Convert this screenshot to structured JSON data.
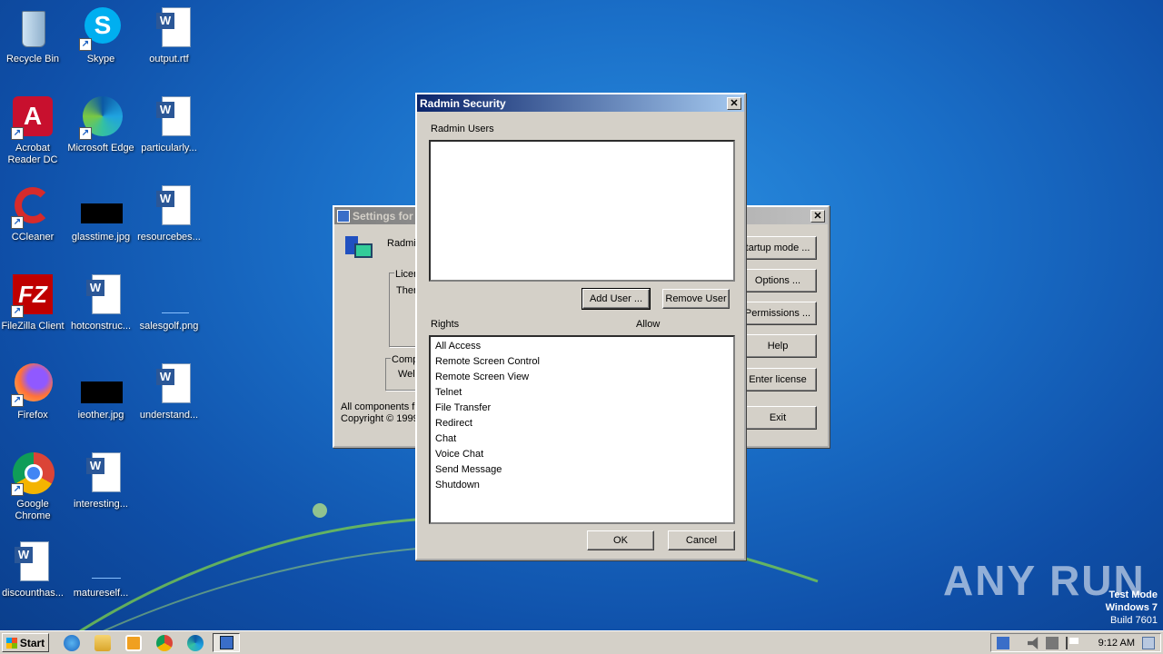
{
  "desktop": {
    "icons": [
      {
        "label": "Recycle Bin"
      },
      {
        "label": "Skype"
      },
      {
        "label": "output.rtf"
      },
      {
        "label": "Acrobat Reader DC"
      },
      {
        "label": "Microsoft Edge"
      },
      {
        "label": "particularly..."
      },
      {
        "label": "CCleaner"
      },
      {
        "label": "glasstime.jpg"
      },
      {
        "label": "resourcebes..."
      },
      {
        "label": "FileZilla Client"
      },
      {
        "label": "hotconstruc..."
      },
      {
        "label": "salesgolf.png"
      },
      {
        "label": "Firefox"
      },
      {
        "label": "ieother.jpg"
      },
      {
        "label": "understand..."
      },
      {
        "label": "Google Chrome"
      },
      {
        "label": "interesting..."
      },
      {
        "label": "discounthas..."
      },
      {
        "label": "matureself..."
      }
    ]
  },
  "settings_window": {
    "title": "Settings for",
    "product": "Radmi",
    "license_group": "Licen",
    "license_text": "Ther",
    "components_group": "Comp",
    "components_text": "Wel",
    "footer_line1": "All components fr",
    "footer_line2": "Copyright © 1999",
    "buttons": {
      "startup_mode": "tartup mode ...",
      "options": "Options ...",
      "permissions": "Permissions ...",
      "help": "Help",
      "enter_license": "Enter license",
      "exit": "Exit"
    },
    "close": "✕"
  },
  "security_dialog": {
    "title": "Radmin Security",
    "users_label": "Radmin Users",
    "add_user": "Add User ...",
    "remove_user": "Remove User",
    "rights_label": "Rights",
    "allow_label": "Allow",
    "rights": [
      "All Access",
      "Remote Screen Control",
      "Remote Screen View",
      "Telnet",
      "File Transfer",
      "Redirect",
      "Chat",
      "Voice Chat",
      "Send Message",
      "Shutdown"
    ],
    "ok": "OK",
    "cancel": "Cancel",
    "close": "✕"
  },
  "taskbar": {
    "start_label": "Start",
    "clock": "9:12 AM"
  },
  "watermark": {
    "text": "ANY RUN",
    "test_mode": "Test Mode",
    "os": "Windows 7",
    "build": "Build 7601"
  }
}
